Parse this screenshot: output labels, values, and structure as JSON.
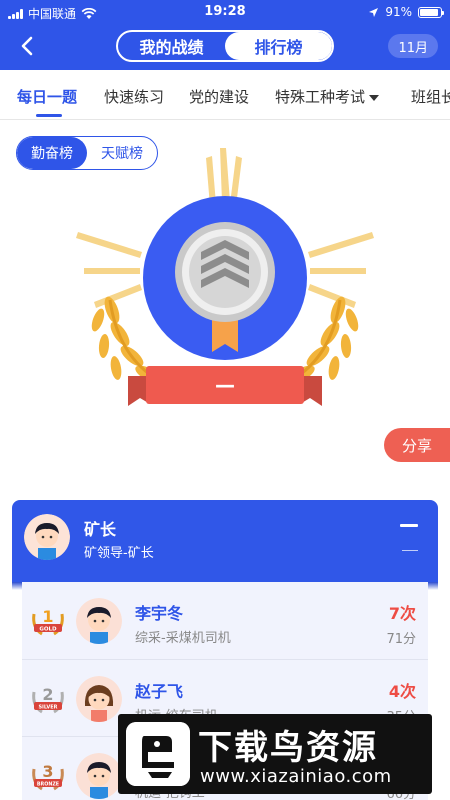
{
  "status_bar": {
    "carrier": "中国联通",
    "time": "19:28",
    "battery": "91%",
    "battery_level": 0.91
  },
  "nav": {
    "seg_left": "我的战绩",
    "seg_right": "排行榜",
    "month": "11月"
  },
  "tabs": [
    "每日一题",
    "快速练习",
    "党的建设",
    "特殊工种考试",
    "班组长"
  ],
  "toggle": {
    "left": "勤奋榜",
    "right": "天赋榜"
  },
  "badge": {
    "ribbon_text": "—"
  },
  "share_label": "分享",
  "panel": {
    "title": "矿长",
    "subtitle": "矿领导-矿长",
    "right_top": "—",
    "right_bottom": "—"
  },
  "ranking": [
    {
      "rank": "1",
      "medal_text": "GOLD",
      "name": "李宇冬",
      "role": "综采-采煤机司机",
      "count": "7次",
      "score": "71分",
      "avatar_style": "boy"
    },
    {
      "rank": "2",
      "medal_text": "SILVER",
      "name": "赵子飞",
      "role": "机运-绞车司机",
      "count": "4次",
      "score": "35分",
      "avatar_style": "girl"
    },
    {
      "rank": "3",
      "medal_text": "BRONZE",
      "name": "",
      "role": "机运-把钩工",
      "count": "",
      "score": "66分",
      "avatar_style": "boy"
    }
  ],
  "watermark": {
    "title": "下载鸟资源",
    "url": "www.xiazainiao.com"
  },
  "colors": {
    "primary": "#2f55e8",
    "accent_red": "#ee4c44",
    "share_bg": "#ee6053",
    "badge_blue": "#3a5cf2",
    "wheat": "#f2b43a"
  }
}
